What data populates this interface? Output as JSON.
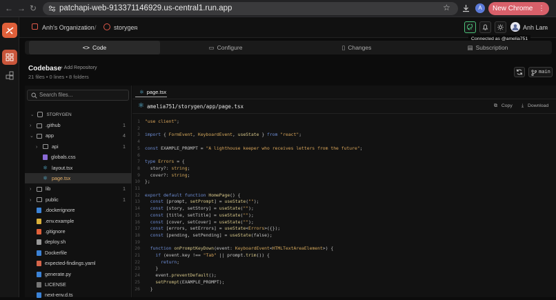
{
  "browser": {
    "url": "patchapi-web-913371146929.us-central1.run.app",
    "profile_initial": "A",
    "new_chrome_label": "New Chrome available",
    "nav_icons": [
      "back-arrow-icon",
      "forward-arrow-icon",
      "reload-icon",
      "site-info-icon",
      "star-icon",
      "download-icon",
      "menu-dots-icon"
    ]
  },
  "header": {
    "org": "Anh's Organization",
    "separator": "/",
    "project": "storygen",
    "user_name": "Anh Lam",
    "tooltip": "Connected as @amelia751"
  },
  "tabs": [
    {
      "label": "Code",
      "active": true
    },
    {
      "label": "Configure",
      "active": false
    },
    {
      "label": "Changes",
      "active": false
    },
    {
      "label": "Subscription",
      "active": false
    }
  ],
  "codebase": {
    "title": "Codebase",
    "add_repo": "+ Add Repository",
    "meta": "21 files • 0 lines • 8 folders",
    "branch": "main"
  },
  "sidebar": {
    "search_placeholder": "Search files...",
    "root": "STORYGEN",
    "items": [
      {
        "label": ".github",
        "count": "1",
        "type": "folder",
        "depth": 0
      },
      {
        "label": "app",
        "count": "4",
        "type": "folder-open",
        "depth": 0
      },
      {
        "label": "api",
        "count": "1",
        "type": "folder",
        "depth": 1
      },
      {
        "label": "globals.css",
        "count": "",
        "type": "css",
        "depth": 1
      },
      {
        "label": "layout.tsx",
        "count": "",
        "type": "react",
        "depth": 1
      },
      {
        "label": "page.tsx",
        "count": "",
        "type": "react",
        "depth": 1,
        "selected": true
      },
      {
        "label": "lib",
        "count": "1",
        "type": "folder",
        "depth": 0
      },
      {
        "label": "public",
        "count": "1",
        "type": "folder",
        "depth": 0
      },
      {
        "label": ".dockerignore",
        "count": "",
        "type": "docker",
        "depth": 0
      },
      {
        "label": ".env.example",
        "count": "",
        "type": "env",
        "depth": 0
      },
      {
        "label": ".gitignore",
        "count": "",
        "type": "git",
        "depth": 0
      },
      {
        "label": "deploy.sh",
        "count": "",
        "type": "shell",
        "depth": 0
      },
      {
        "label": "Dockerfile",
        "count": "",
        "type": "docker",
        "depth": 0
      },
      {
        "label": "expected-findings.yaml",
        "count": "",
        "type": "yaml",
        "depth": 0
      },
      {
        "label": "generate.py",
        "count": "",
        "type": "python",
        "depth": 0
      },
      {
        "label": "LICENSE",
        "count": "",
        "type": "file",
        "depth": 0
      },
      {
        "label": "next-env.d.ts",
        "count": "",
        "type": "ts",
        "depth": 0
      }
    ]
  },
  "editor": {
    "tab": "page.tsx",
    "path": "amelia751/storygen/app/page.tsx",
    "copy_label": "Copy",
    "download_label": "Download",
    "lines": [
      "\"use client\";",
      "",
      "import { FormEvent, KeyboardEvent, useState } from \"react\";",
      "",
      "const EXAMPLE_PROMPT = \"A lighthouse keeper who receives letters from the future\";",
      "",
      "type Errors = {",
      "  story?: string;",
      "  cover?: string;",
      "};",
      "",
      "export default function HomePage() {",
      "  const [prompt, setPrompt] = useState(\"\");",
      "  const [story, setStory] = useState(\"\");",
      "  const [title, setTitle] = useState(\"\");",
      "  const [cover, setCover] = useState(\"\");",
      "  const [errors, setErrors] = useState<Errors>({});",
      "  const [pending, setPending] = useState(false);",
      "",
      "  function onPromptKeyDown(event: KeyboardEvent<HTMLTextAreaElement>) {",
      "    if (event.key !== \"Tab\" || prompt.trim()) {",
      "      return;",
      "    }",
      "    event.preventDefault();",
      "    setPrompt(EXAMPLE_PROMPT);",
      "  }"
    ]
  },
  "colors": {
    "accent_orange": "#e0603a",
    "keyword": "#6f8fd8",
    "string": "#d9a55a",
    "type": "#d6a95c",
    "selected_row": "#2a2a2a",
    "connected_green": "#4cc27a"
  }
}
